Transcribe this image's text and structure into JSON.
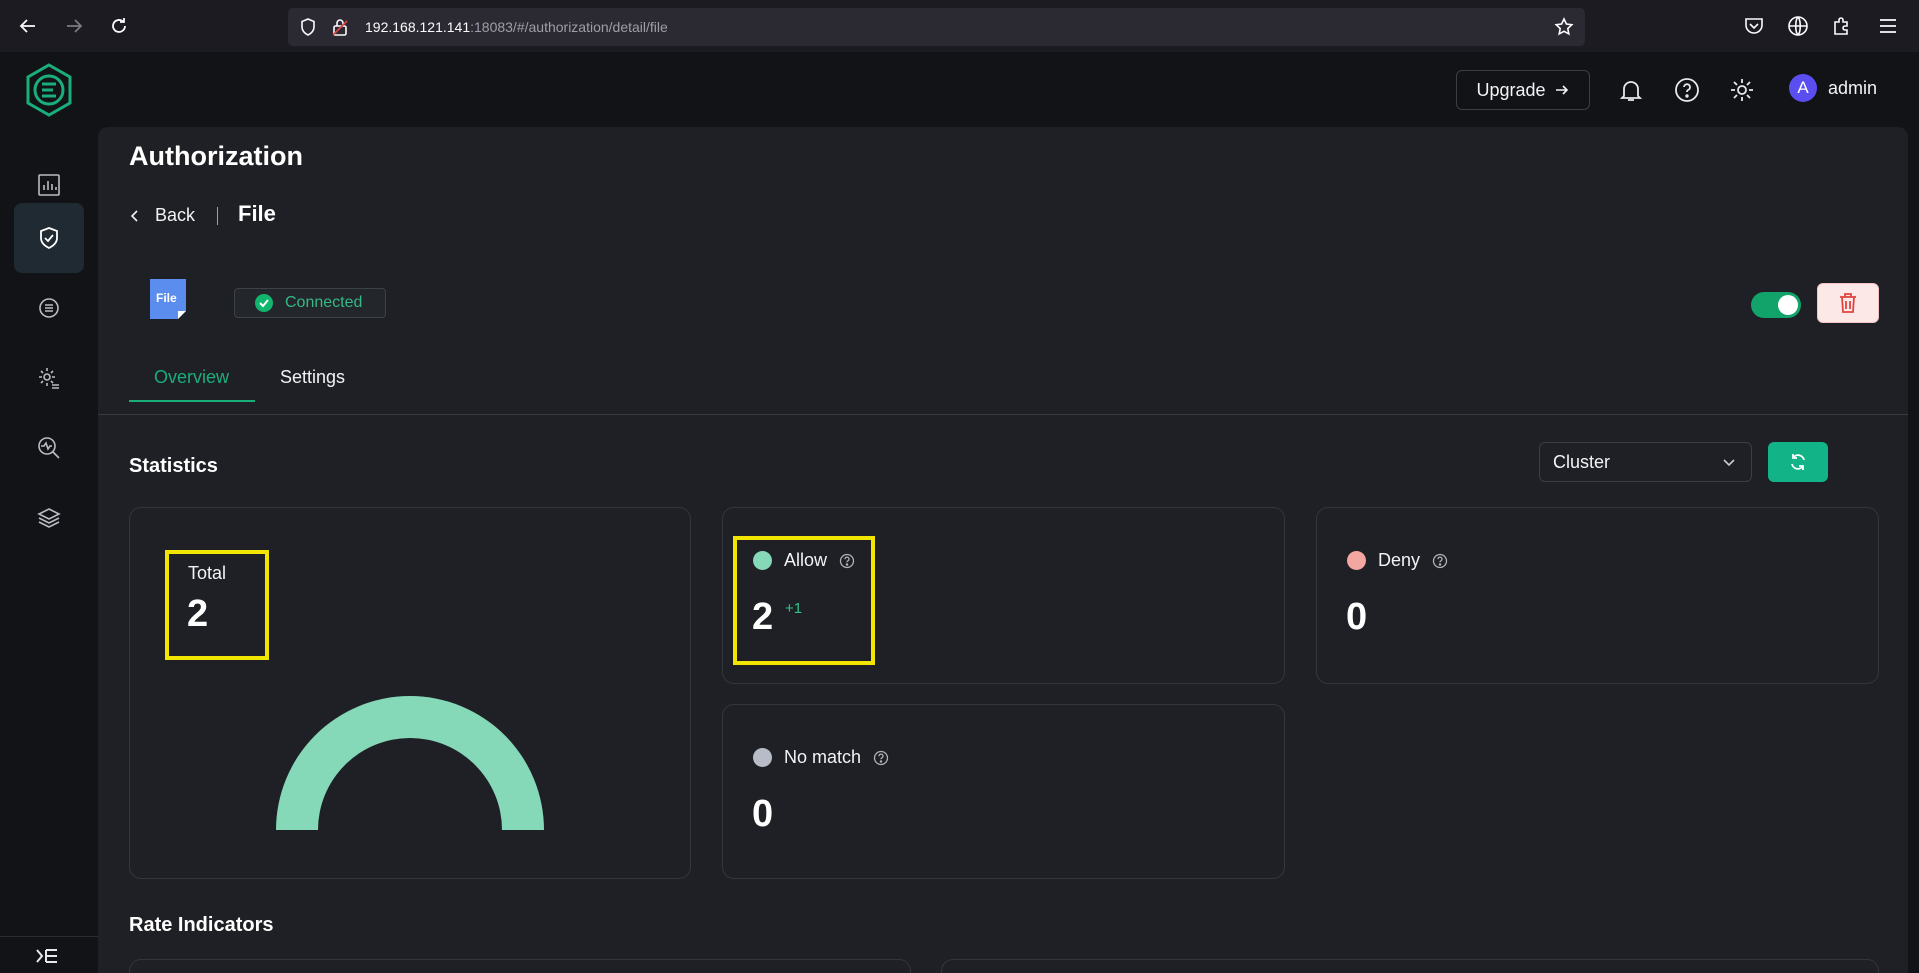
{
  "browser": {
    "url_host": "192.168.121.141",
    "url_rest": ":18083/#/authorization/detail/file"
  },
  "header": {
    "upgrade_label": "Upgrade",
    "avatar_letter": "A",
    "username": "admin"
  },
  "page": {
    "title": "Authorization",
    "back_label": "Back",
    "breadcrumb_current": "File",
    "file_logo_text": "File",
    "status": "Connected",
    "enabled": true
  },
  "tabs": [
    {
      "label": "Overview",
      "active": true
    },
    {
      "label": "Settings",
      "active": false
    }
  ],
  "statistics": {
    "title": "Statistics",
    "scope_selected": "Cluster",
    "total": {
      "label": "Total",
      "value": "2"
    },
    "allow": {
      "label": "Allow",
      "value": "2",
      "delta": "+1",
      "color": "#85d8b8"
    },
    "deny": {
      "label": "Deny",
      "value": "0",
      "color": "#f4a6a0"
    },
    "no_match": {
      "label": "No match",
      "value": "0",
      "color": "#b7bcc6"
    }
  },
  "rate_indicators": {
    "title": "Rate Indicators"
  },
  "colors": {
    "accent": "#12b386",
    "highlight": "#f2e600"
  }
}
